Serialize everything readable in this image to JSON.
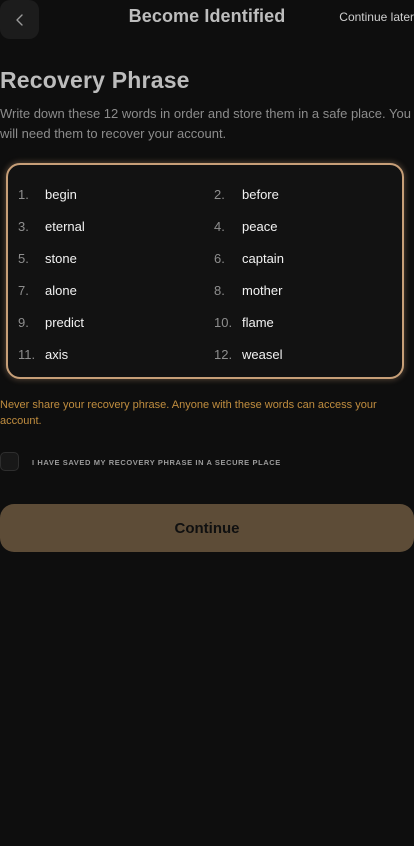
{
  "header": {
    "title": "Become Identified",
    "continue_later": "Continue later",
    "back_icon": "chevron-left-icon"
  },
  "content": {
    "title": "Recovery Phrase",
    "description": "Write down these 12 words in order and store them in a safe place. You will need them to recover your account."
  },
  "phrase": {
    "words": [
      {
        "num": "1.",
        "word": "begin"
      },
      {
        "num": "2.",
        "word": "before"
      },
      {
        "num": "3.",
        "word": "eternal"
      },
      {
        "num": "4.",
        "word": "peace"
      },
      {
        "num": "5.",
        "word": "stone"
      },
      {
        "num": "6.",
        "word": "captain"
      },
      {
        "num": "7.",
        "word": "alone"
      },
      {
        "num": "8.",
        "word": "mother"
      },
      {
        "num": "9.",
        "word": "predict"
      },
      {
        "num": "10.",
        "word": "flame"
      },
      {
        "num": "11.",
        "word": "axis"
      },
      {
        "num": "12.",
        "word": "weasel"
      }
    ]
  },
  "warning": "Never share your recovery phrase. Anyone with these words can access your account.",
  "confirm": {
    "label": "I HAVE SAVED MY RECOVERY PHRASE IN A SECURE PLACE",
    "checked": false
  },
  "actions": {
    "continue_label": "Continue"
  },
  "colors": {
    "background": "#0e0e0e",
    "accent_border": "#c79f78",
    "warning": "#c08d3f",
    "button": "#5d4c37"
  }
}
